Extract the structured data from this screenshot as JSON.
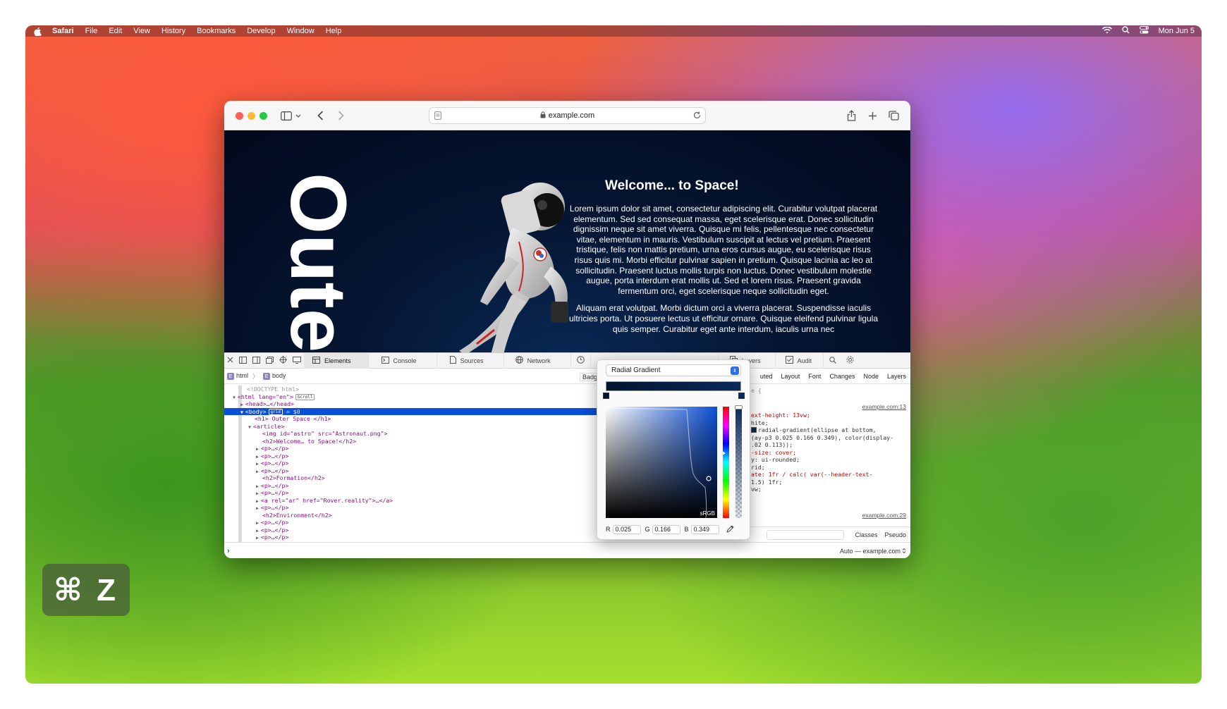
{
  "menubar": {
    "app": "Safari",
    "items": [
      "File",
      "Edit",
      "View",
      "History",
      "Bookmarks",
      "Develop",
      "Window",
      "Help"
    ],
    "clock": "Mon Jun 5"
  },
  "browser": {
    "url": "example.com"
  },
  "page": {
    "vertical_title": "Oute",
    "heading": "Welcome... to Space!",
    "paragraph1": "Lorem ipsum dolor sit amet, consectetur adipiscing elit. Curabitur volutpat placerat elementum. Sed sed consequat massa, eget scelerisque erat. Donec sollicitudin dignissim neque sit amet viverra. Quisque mi felis, pellentesque nec consectetur vitae, elementum in mauris. Vestibulum suscipit at lectus vel pretium. Praesent tristique, felis non mattis pretium, urna eros cursus augue, eu scelerisque risus risus quis mi. Morbi efficitur pulvinar sapien in pretium. Quisque lacinia ac leo at sollicitudin. Praesent luctus mollis turpis non luctus. Donec vestibulum molestie augue, porta interdum erat mollis ut. Sed et lorem risus. Praesent gravida fermentum orci, eget scelerisque neque sollicitudin eget.",
    "paragraph2": "Aliquam erat volutpat. Morbi dictum orci a viverra placerat. Suspendisse iaculis ultricies porta. Ut posuere lectus ut efficitur ornare. Quisque eleifend pulvinar ligula quis semper. Curabitur eget ante interdum, iaculis urna nec"
  },
  "devtools": {
    "tabs": [
      "Elements",
      "Console",
      "Sources",
      "Network",
      "Layers",
      "Audit"
    ],
    "breadcrumb": [
      "html",
      "body"
    ],
    "badge_label": "Badg",
    "sidebar_tabs": [
      "uted",
      "Layout",
      "Font",
      "Changes",
      "Node",
      "Layers"
    ],
    "dom_lines": [
      {
        "t": "<!DOCTYPE html>",
        "c": "cmt",
        "i": 1
      },
      {
        "t": "<html lang=\"en\">",
        "c": "tag",
        "i": 0,
        "arrow": "▼",
        "pill": "Scroll"
      },
      {
        "t": "<head>…</head>",
        "c": "tag",
        "i": 1,
        "arrow": "▶"
      },
      {
        "t": "<body>",
        "c": "tag",
        "i": 1,
        "arrow": "▼",
        "pill": "grid",
        "extra": " = $0",
        "sel": true
      },
      {
        "t": "<h1> Outer Space </h1>",
        "c": "tag",
        "i": 2
      },
      {
        "t": "<article>",
        "c": "tag",
        "i": 2,
        "arrow": "▼"
      },
      {
        "t": "<img id=\"astro\" src=\"Astronaut.png\">",
        "c": "tag",
        "i": 3
      },
      {
        "t": "<h2>Welcome… to Space!</h2>",
        "c": "tag",
        "i": 3
      },
      {
        "t": "<p>…</p>",
        "c": "tag",
        "i": 3,
        "arrow": "▶"
      },
      {
        "t": "<p>…</p>",
        "c": "tag",
        "i": 3,
        "arrow": "▶"
      },
      {
        "t": "<p>…</p>",
        "c": "tag",
        "i": 3,
        "arrow": "▶"
      },
      {
        "t": "<p>…</p>",
        "c": "tag",
        "i": 3,
        "arrow": "▶"
      },
      {
        "t": "<h2>Formation</h2>",
        "c": "tag",
        "i": 3
      },
      {
        "t": "<p>…</p>",
        "c": "tag",
        "i": 3,
        "arrow": "▶"
      },
      {
        "t": "<p>…</p>",
        "c": "tag",
        "i": 3,
        "arrow": "▶"
      },
      {
        "t": "<a rel=\"ar\" href=\"Rover.reality\">…</a>",
        "c": "tag",
        "i": 3,
        "arrow": "▶"
      },
      {
        "t": "<p>…</p>",
        "c": "tag",
        "i": 3,
        "arrow": "▶"
      },
      {
        "t": "<h2>Environment</h2>",
        "c": "tag",
        "i": 3
      },
      {
        "t": "<p>…</p>",
        "c": "tag",
        "i": 3,
        "arrow": "▶"
      },
      {
        "t": "<p>…</p>",
        "c": "tag",
        "i": 3,
        "arrow": "▶"
      },
      {
        "t": "<p>…</p>",
        "c": "tag",
        "i": 3,
        "arrow": "▶"
      }
    ],
    "css_source1": "example.com:13",
    "css_lines": [
      "e {",
      "",
      "ext-height: 13vw;",
      "hite;",
      "  radial-gradient(ellipse at bottom,",
      "(ay-p3 0.025 0.166 0.349), color(display-",
      ".02 0.113));",
      "-size: cover;",
      "y: ui-rounded;",
      "rid;",
      "ate: 1fr / calc(  var(--header-text-",
      "1.5) 1fr;",
      "vw;"
    ],
    "css_source2": "example.com:29",
    "filter_buttons": [
      "Classes",
      "Pseudo"
    ],
    "console_target": "Auto — example.com"
  },
  "color_picker": {
    "mode": "Radial Gradient",
    "colorspace": "sRGB",
    "r_label": "R",
    "r": "0.025",
    "g_label": "G",
    "g": "0.166",
    "b_label": "B",
    "b": "0.349"
  },
  "shortcut": "⌘ Z"
}
